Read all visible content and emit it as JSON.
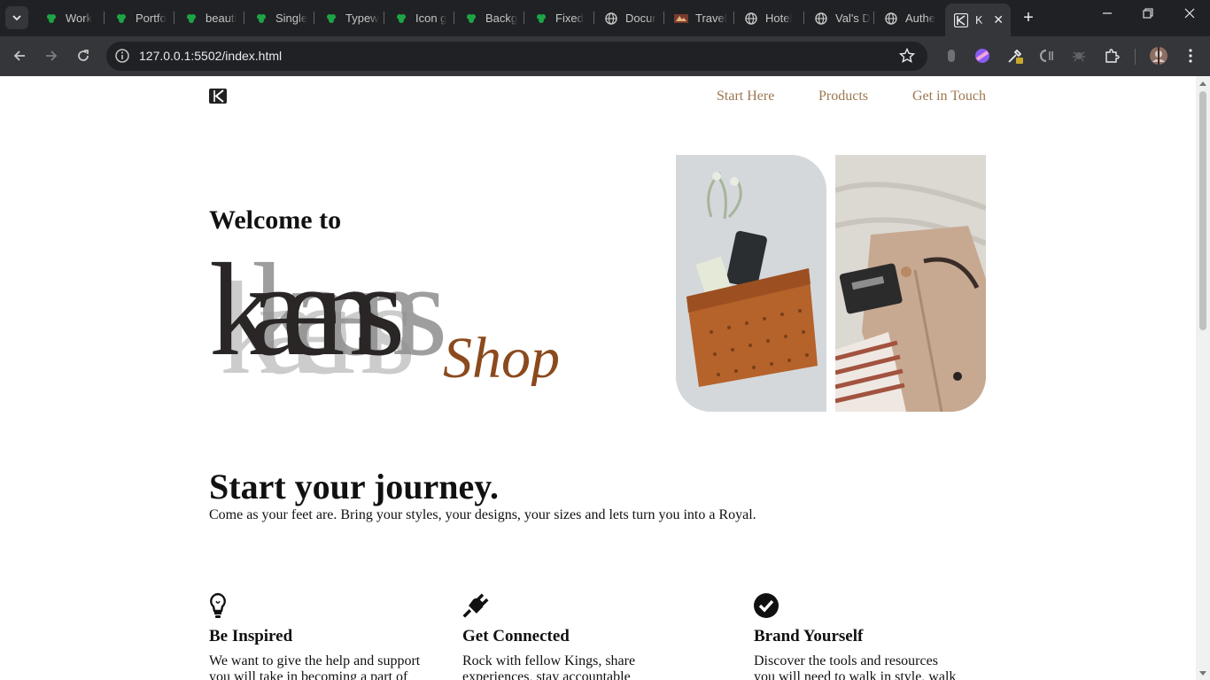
{
  "browser": {
    "tabs": [
      {
        "label": "Work",
        "icon": "green-leaf-icon"
      },
      {
        "label": "Portfo",
        "icon": "green-leaf-icon"
      },
      {
        "label": "beauti",
        "icon": "green-leaf-icon"
      },
      {
        "label": "Single",
        "icon": "green-leaf-icon"
      },
      {
        "label": "Typew",
        "icon": "green-leaf-icon"
      },
      {
        "label": "Icon g",
        "icon": "green-leaf-icon"
      },
      {
        "label": "Backg",
        "icon": "green-leaf-icon"
      },
      {
        "label": "Fixed",
        "icon": "green-leaf-icon"
      },
      {
        "label": "Docur",
        "icon": "globe-icon"
      },
      {
        "label": "Travel",
        "icon": "travel-site-icon"
      },
      {
        "label": "Hotel",
        "icon": "globe-icon"
      },
      {
        "label": "Val's D",
        "icon": "globe-icon"
      },
      {
        "label": "Authe",
        "icon": "globe-icon"
      },
      {
        "label": "K",
        "icon": "kaens-logo-icon",
        "active": true
      }
    ],
    "address": "127.0.0.1:5502/index.html"
  },
  "site": {
    "nav": [
      "Start Here",
      "Products",
      "Get in Touch"
    ],
    "hero": {
      "welcome": "Welcome to",
      "brand_word": "kaens",
      "brand_suffix": "Shop"
    },
    "journey": {
      "heading": "Start your journey.",
      "subtitle": "Come as your feet are. Bring your styles, your designs, your sizes and lets turn you into a Royal."
    },
    "features": [
      {
        "icon": "lightbulb-icon",
        "title": "Be Inspired",
        "line1": "We want to give the help and support",
        "line2": "you will take in becoming a part of"
      },
      {
        "icon": "plug-icon",
        "title": "Get Connected",
        "line1": "Rock with fellow Kings, share",
        "line2": "experiences, stay accountable"
      },
      {
        "icon": "check-circle-icon",
        "title": "Brand Yourself",
        "line1": "Discover the tools and resources",
        "line2": "you will need to walk in style, walk"
      }
    ]
  },
  "colors": {
    "nav_link": "#9c7750",
    "shop_script": "#8b4a1e",
    "chrome_dark": "#202124",
    "chrome_mid": "#35363a"
  }
}
